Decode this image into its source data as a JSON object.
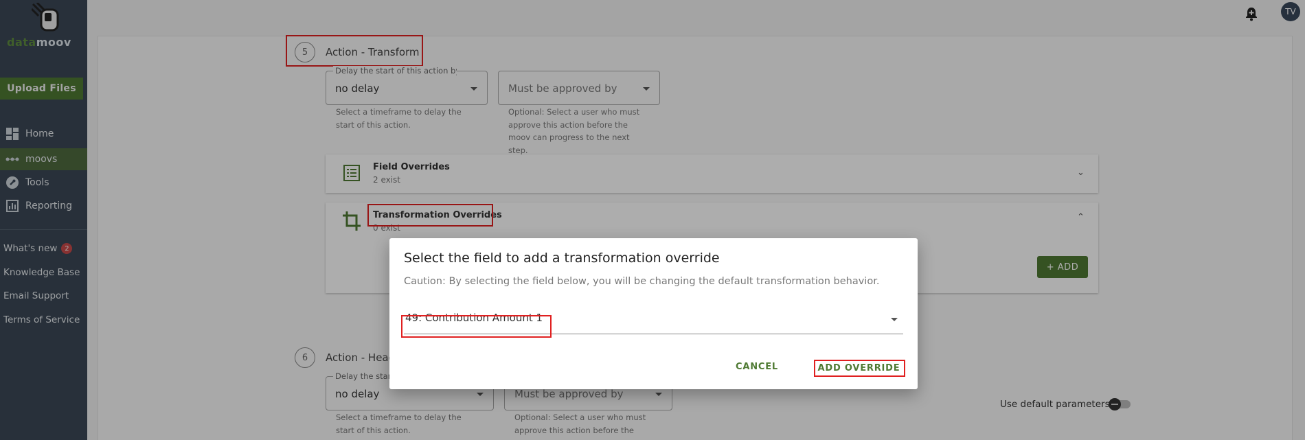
{
  "sidebar": {
    "logo_part1": "data",
    "logo_part2": "moov",
    "upload_label": "Upload Files",
    "nav": [
      {
        "label": "Home"
      },
      {
        "label": "moovs"
      },
      {
        "label": "Tools"
      },
      {
        "label": "Reporting"
      }
    ],
    "links": {
      "whats_new": "What's new",
      "whats_new_count": "2",
      "knowledge_base": "Knowledge Base",
      "email_support": "Email Support",
      "terms": "Terms of Service"
    }
  },
  "topbar": {
    "avatar_initials": "TV"
  },
  "step5": {
    "number": "5",
    "title": "Action - Transform",
    "delay_legend": "Delay the start of this action by",
    "delay_value": "no delay",
    "delay_helper": "Select a timeframe to delay the start of this action.",
    "approval_placeholder": "Must be approved by",
    "approval_helper": "Optional: Select a user who must approve this action before the moov can progress to the next step.",
    "field_overrides_title": "Field Overrides",
    "field_overrides_count": "2 exist",
    "transformation_overrides_title": "Transformation Overrides",
    "transformation_overrides_count": "0 exist",
    "add_label": "+ ADD"
  },
  "step6": {
    "number": "6",
    "title": "Action - Head",
    "delay_legend": "Delay the start",
    "delay_value": "no delay",
    "delay_helper": "Select a timeframe to delay the start of this action.",
    "approval_placeholder": "Must be approved by",
    "approval_helper": "Optional: Select a user who must approve this action before the",
    "toggle_label": "Use default parameters"
  },
  "dialog": {
    "title": "Select the field to add a transformation override",
    "caution": "Caution: By selecting the field below, you will be changing the default transformation behavior.",
    "selected_field": "49: Contribution Amount 1",
    "cancel_label": "CANCEL",
    "confirm_label": "ADD OVERRIDE"
  },
  "colors": {
    "sidebar_bg": "#3b4756",
    "accent_green": "#4f7a33",
    "highlight_red": "#e02020"
  }
}
